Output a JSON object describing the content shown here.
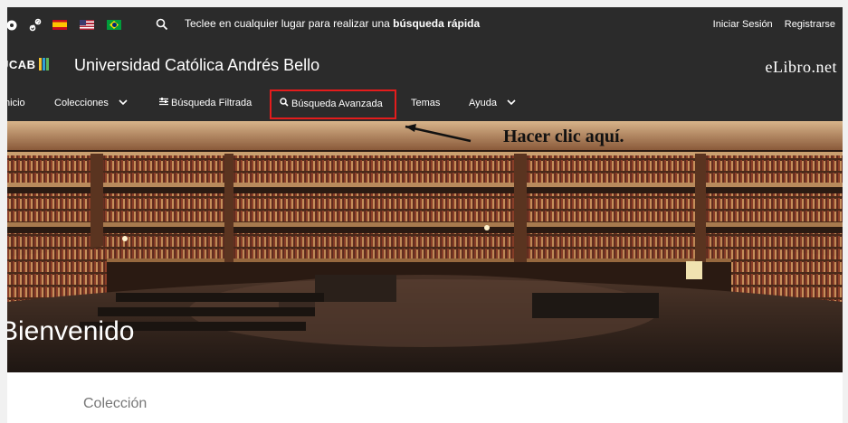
{
  "topbar": {
    "search_prefix": "Teclee en cualquier lugar para realizar una ",
    "search_bold": "búsqueda rápida",
    "login": "Iniciar Sesión",
    "register": "Registrarse",
    "icons": [
      "github-icon",
      "link-icon",
      "flag-es-icon",
      "flag-us-icon",
      "flag-br-icon",
      "search-icon"
    ]
  },
  "header": {
    "logo_text": "UCAB",
    "university": "Universidad Católica Andrés Bello",
    "brand": "eLibro.net"
  },
  "nav": {
    "items": [
      "Inicio",
      "Colecciones",
      "Búsqueda Filtrada",
      "Búsqueda Avanzada",
      "Temas",
      "Ayuda"
    ],
    "highlight_color": "#e41c1c"
  },
  "hero": {
    "welcome": "Bienvenido",
    "callout": "Hacer clic aquí."
  },
  "section": {
    "title": "Colección"
  },
  "colors": {
    "bar": "#2b2b2b",
    "callout_arrow": "#111111"
  }
}
